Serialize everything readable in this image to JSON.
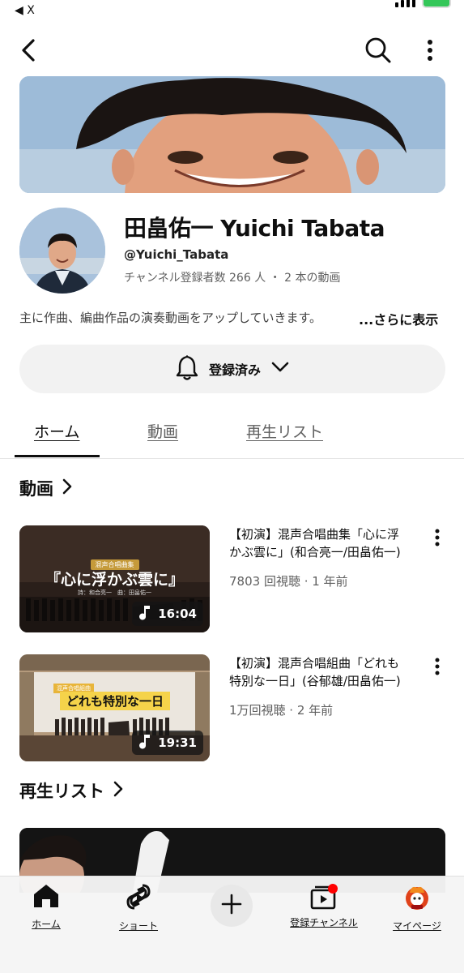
{
  "status_bar": {
    "back_label": "◀ X"
  },
  "channel": {
    "name": "田畠佑一 Yuichi Tabata",
    "handle": "@Yuichi_Tabata",
    "stats": "チャンネル登録者数 266 人 ・ 2 本の動画",
    "description": "主に作曲、編曲作品の演奏動画をアップしていきます。",
    "more_label": "...さらに表示"
  },
  "subscribe": {
    "label": "登録済み"
  },
  "tabs": [
    {
      "label": "ホーム",
      "active": true
    },
    {
      "label": "動画",
      "active": false
    },
    {
      "label": "再生リスト",
      "active": false
    }
  ],
  "sections": {
    "videos_title": "動画",
    "playlists_title": "再生リスト"
  },
  "videos": [
    {
      "title": "【初演】混声合唱曲集「心に浮かぶ雲に」(和合亮一/田畠佑一)",
      "meta": "7803 回視聴 · 1 年前",
      "duration": "16:04",
      "thumb_caption_small": "混声合唱曲集",
      "thumb_caption_main": "『心に浮かぶ雲に』",
      "thumb_caption_sub": "詩：和合亮一　曲：田畠佑一"
    },
    {
      "title": "【初演】混声合唱組曲「どれも特別な一日」(谷郁雄/田畠佑一)",
      "meta": "1万回視聴 · 2 年前",
      "duration": "19:31",
      "thumb_caption_small": "混声合唱組曲",
      "thumb_caption_main": "どれも特別な一日"
    }
  ],
  "bottom_nav": [
    {
      "label": "ホーム",
      "icon": "home-icon"
    },
    {
      "label": "ショート",
      "icon": "shorts-icon"
    },
    {
      "label": "",
      "icon": "create-icon"
    },
    {
      "label": "登録チャンネル",
      "icon": "subscriptions-icon"
    },
    {
      "label": "マイページ",
      "icon": "avatar-icon"
    }
  ],
  "colors": {
    "accent_red": "#ff0000",
    "battery_green": "#34c759"
  }
}
